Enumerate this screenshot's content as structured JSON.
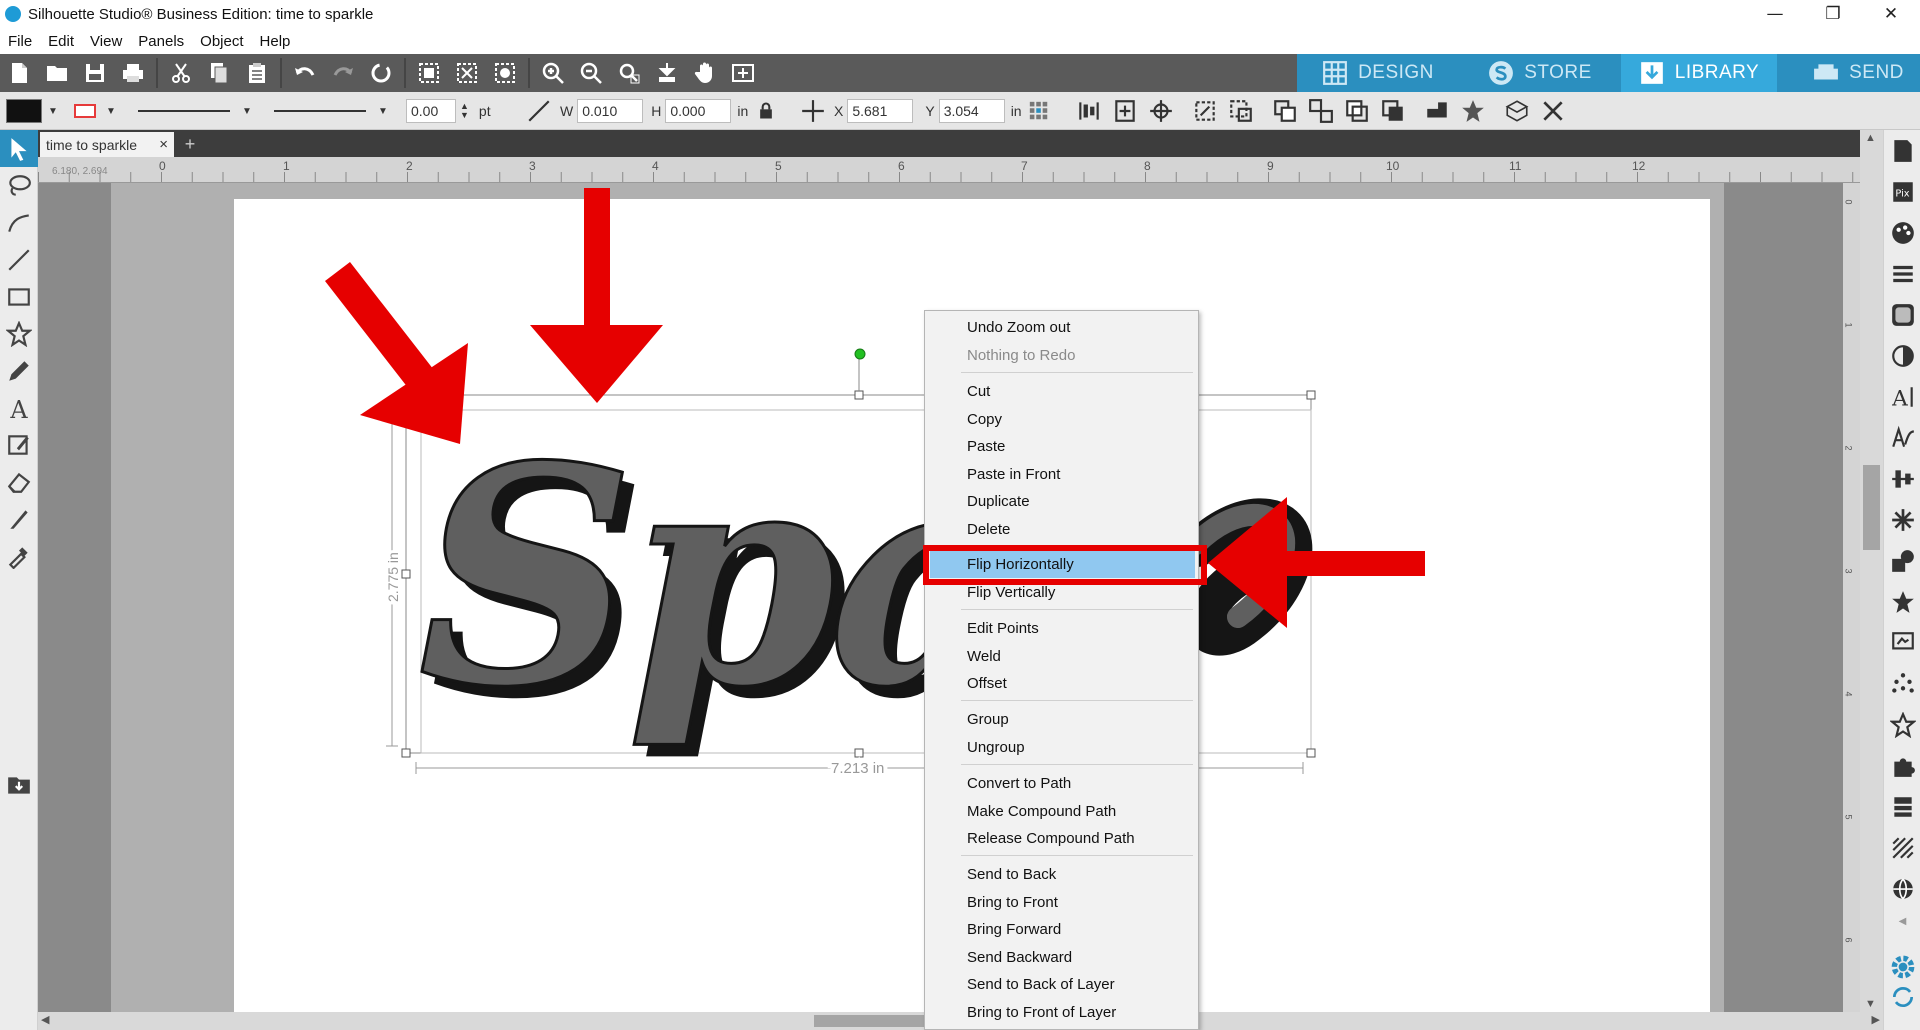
{
  "window": {
    "title": "Silhouette Studio® Business Edition: time to sparkle",
    "minimize": "—",
    "restore": "❐",
    "close": "✕"
  },
  "menu": [
    "File",
    "Edit",
    "View",
    "Panels",
    "Object",
    "Help"
  ],
  "modes": {
    "design": "DESIGN",
    "store": "STORE",
    "library": "LIBRARY",
    "send": "SEND",
    "active": "LIBRARY"
  },
  "line_props": {
    "width_value": "0.00",
    "width_unit": "pt"
  },
  "size": {
    "w_label": "W",
    "w_value": "0.010",
    "h_label": "H",
    "h_value": "0.000",
    "unit": "in"
  },
  "position": {
    "x_label": "X",
    "x_value": "5.681",
    "y_label": "Y",
    "y_value": "3.054",
    "unit": "in"
  },
  "tab": {
    "name": "time to sparkle",
    "close": "×",
    "add": "+"
  },
  "ruler": {
    "cursor_readout": "6.180, 2.694",
    "h_ticks": [
      "0",
      "1",
      "2",
      "3",
      "4",
      "5",
      "6",
      "7",
      "8",
      "9",
      "10",
      "11",
      "12"
    ],
    "v_ticks": [
      "0",
      "1",
      "2",
      "3",
      "4",
      "5",
      "6"
    ]
  },
  "canvas": {
    "text": "Sparkle",
    "visible_text": "Spar",
    "width_dim": "7.213 in",
    "height_dim": "2.775 in"
  },
  "context_menu": {
    "items": [
      {
        "label": "Undo Zoom out",
        "enabled": true
      },
      {
        "label": "Nothing to Redo",
        "enabled": false
      },
      {
        "label": "Cut",
        "enabled": true
      },
      {
        "label": "Copy",
        "enabled": true
      },
      {
        "label": "Paste",
        "enabled": true
      },
      {
        "label": "Paste in Front",
        "enabled": true
      },
      {
        "label": "Duplicate",
        "enabled": true
      },
      {
        "label": "Delete",
        "enabled": true
      },
      {
        "label": "Flip Horizontally",
        "enabled": true,
        "highlighted": true
      },
      {
        "label": "Flip Vertically",
        "enabled": true
      },
      {
        "label": "Edit Points",
        "enabled": true
      },
      {
        "label": "Weld",
        "enabled": true
      },
      {
        "label": "Offset",
        "enabled": true
      },
      {
        "label": "Group",
        "enabled": true
      },
      {
        "label": "Ungroup",
        "enabled": true
      },
      {
        "label": "Convert to Path",
        "enabled": true
      },
      {
        "label": "Make Compound Path",
        "enabled": true
      },
      {
        "label": "Release Compound Path",
        "enabled": true
      },
      {
        "label": "Send to Back",
        "enabled": true
      },
      {
        "label": "Bring to Front",
        "enabled": true
      },
      {
        "label": "Bring Forward",
        "enabled": true
      },
      {
        "label": "Send Backward",
        "enabled": true
      },
      {
        "label": "Send to Back of Layer",
        "enabled": true
      },
      {
        "label": "Bring to Front of Layer",
        "enabled": true
      }
    ]
  },
  "colors": {
    "toolbar_dark": "#5a5a5a",
    "mode_tab": "#2b8fbf",
    "mode_tab_active": "#36a9dc",
    "menu_highlight": "#90c8f0",
    "annotation_red": "#e60000"
  },
  "annotations": {
    "arrows": [
      "red-arrow-diagonal",
      "red-arrow-down",
      "red-arrow-left"
    ],
    "highlight_target": "Flip Horizontally"
  }
}
